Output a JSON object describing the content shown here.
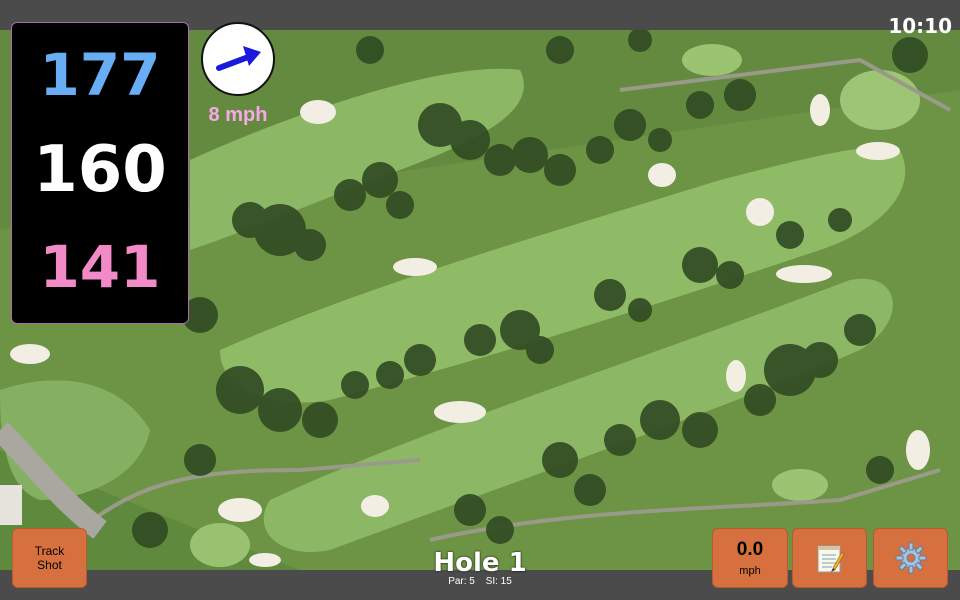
{
  "status_bar": {
    "time": "10:10"
  },
  "distances": {
    "back": "177",
    "middle": "160",
    "front": "141"
  },
  "wind": {
    "speed_label": "8 mph",
    "direction_icon": "arrow-icon"
  },
  "hole": {
    "title": "Hole 1",
    "par": "Par: 5",
    "stroke_index": "SI: 15"
  },
  "buttons": {
    "track_shot_line1": "Track",
    "track_shot_line2": "Shot",
    "wind_value": "0.0",
    "wind_unit": "mph",
    "notes_icon": "notepad-icon",
    "settings_icon": "gear-icon"
  },
  "colors": {
    "back_distance": "#68aef5",
    "middle_distance": "#ffffff",
    "front_distance": "#f28ac8",
    "wind_label": "#f6a8e8",
    "button_bg": "#d7703f"
  }
}
